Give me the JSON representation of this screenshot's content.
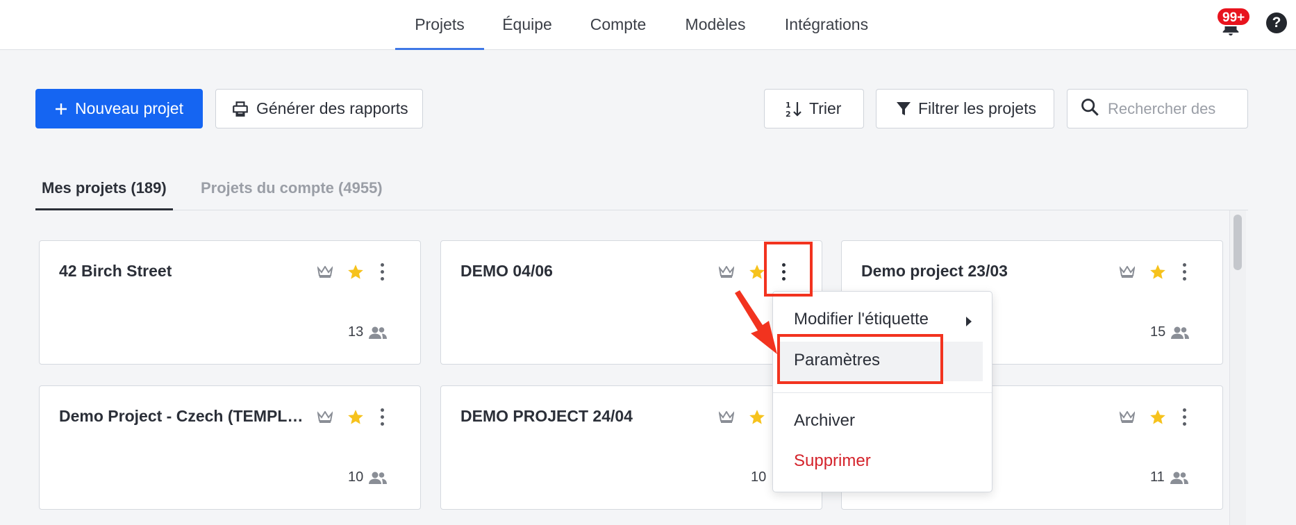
{
  "nav": {
    "items": [
      {
        "label": "Projets",
        "active": true
      },
      {
        "label": "Équipe",
        "active": false
      },
      {
        "label": "Compte",
        "active": false
      },
      {
        "label": "Modèles",
        "active": false
      },
      {
        "label": "Intégrations",
        "active": false
      }
    ],
    "notifications_badge": "99+",
    "help_label": "?"
  },
  "toolbar": {
    "new_project": "Nouveau projet",
    "generate_reports": "Générer des rapports",
    "sort": "Trier",
    "filter": "Filtrer les projets",
    "search_placeholder": "Rechercher des"
  },
  "tabs": [
    {
      "label": "Mes projets (189)",
      "active": true
    },
    {
      "label": "Projets du compte (4955)",
      "active": false
    }
  ],
  "cards": [
    {
      "title": "42 Birch Street",
      "members": "13",
      "starred": true
    },
    {
      "title": "DEMO 04/06",
      "members": "",
      "starred": true
    },
    {
      "title": "Demo project 23/03",
      "members": "15",
      "starred": true
    },
    {
      "title": "Demo Project - Czech (TEMPLAT…",
      "members": "10",
      "starred": true
    },
    {
      "title": "DEMO PROJECT 24/04",
      "members": "10",
      "starred": true
    },
    {
      "title": "",
      "members": "11",
      "starred": true
    }
  ],
  "context_menu": {
    "items": {
      "edit_label": "Modifier l'étiquette",
      "settings": "Paramètres",
      "archive": "Archiver",
      "delete": "Supprimer"
    },
    "delete_color": "#d4232b"
  },
  "colors": {
    "primary": "#1565f2",
    "accent_underline": "#3f78e6",
    "star": "#f6c21c",
    "annotation": "#f2331f",
    "badge": "#e8141e"
  }
}
